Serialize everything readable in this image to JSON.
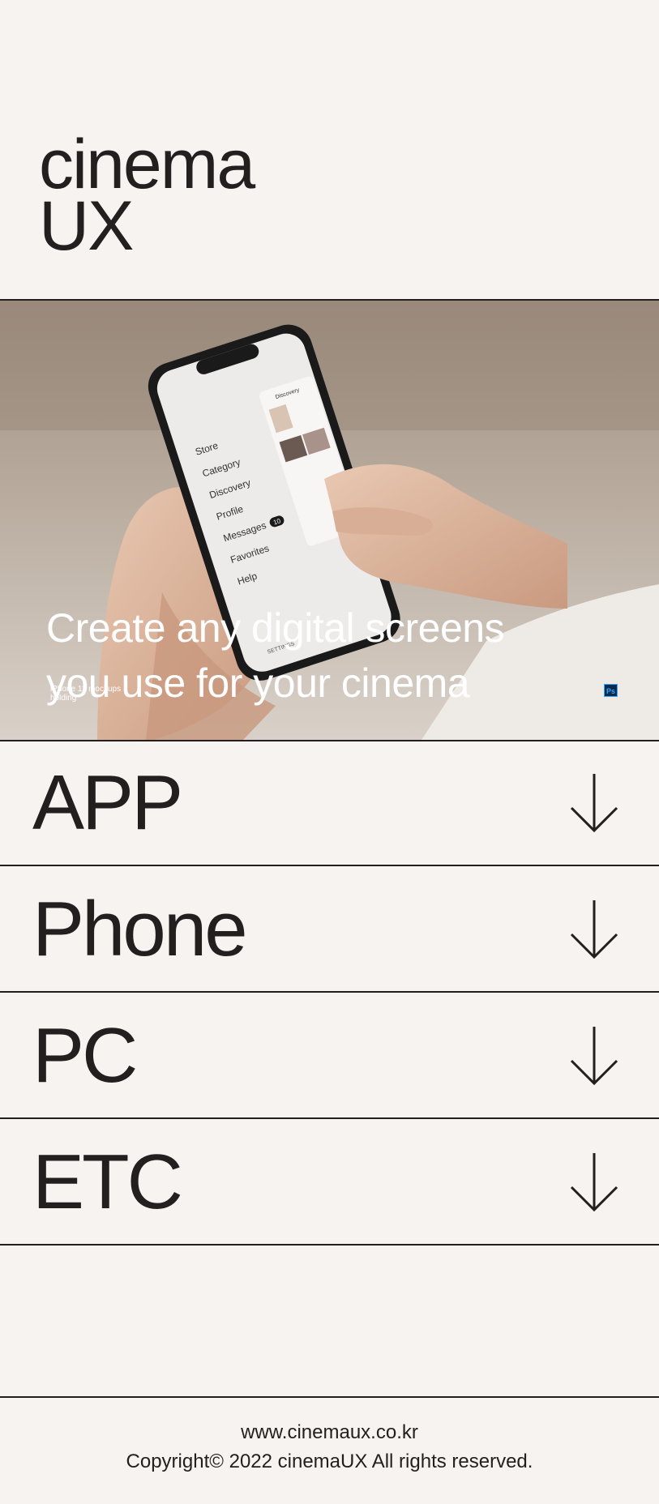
{
  "header": {
    "logo_line1": "cinema",
    "logo_line2": "UX"
  },
  "hero": {
    "headline_line1": "Create any digital screens",
    "headline_line2": "you use for your cinema",
    "mockup_caption": "iPhone 11 mockups holding",
    "ps_badge": "Ps",
    "phone_menu": [
      "Store",
      "Category",
      "Discovery",
      "Profile",
      "Messages",
      "Favorites",
      "Help"
    ],
    "phone_messages_badge": "10",
    "phone_panel_title": "Discovery",
    "phone_settings_label": "SETTINGS"
  },
  "categories": [
    {
      "label": "APP",
      "icon": "arrow-down-icon"
    },
    {
      "label": "Phone",
      "icon": "arrow-down-icon"
    },
    {
      "label": "PC",
      "icon": "arrow-down-icon"
    },
    {
      "label": "ETC",
      "icon": "arrow-down-icon"
    }
  ],
  "footer": {
    "url": "www.cinemaux.co.kr",
    "copyright": "Copyright© 2022 cinemaUX All rights reserved."
  },
  "colors": {
    "background": "#f6f3f0",
    "text": "#231f1e",
    "hero_text": "#ffffff"
  }
}
